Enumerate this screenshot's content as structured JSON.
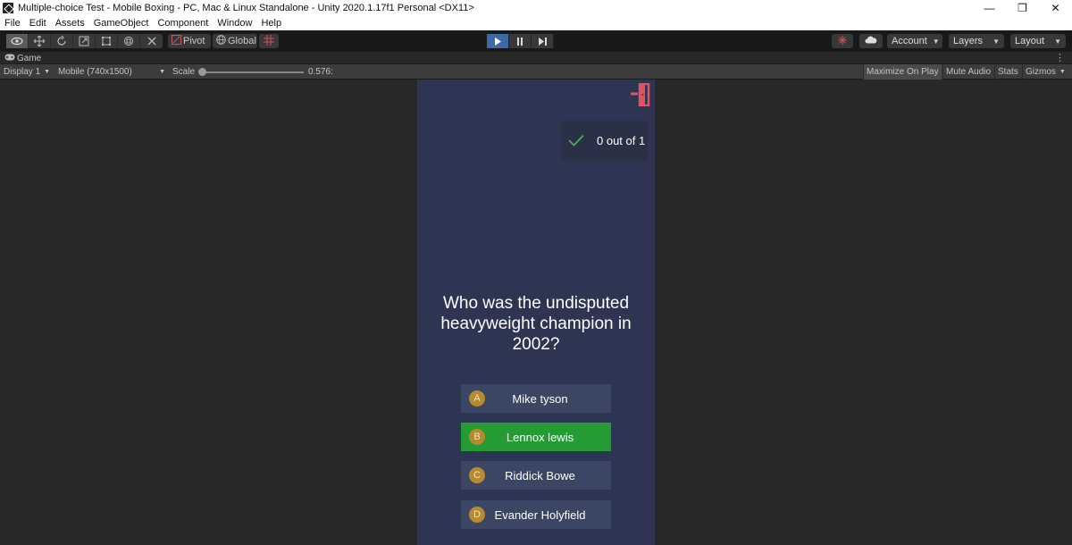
{
  "window": {
    "title": "Multiple-choice Test - Mobile Boxing - PC, Mac & Linux Standalone - Unity 2020.1.17f1 Personal <DX11>",
    "controls": {
      "minimize": "—",
      "restore": "❐",
      "close": "✕"
    }
  },
  "menu": {
    "items": [
      {
        "label": "File"
      },
      {
        "label": "Edit"
      },
      {
        "label": "Assets"
      },
      {
        "label": "GameObject"
      },
      {
        "label": "Component"
      },
      {
        "label": "Window"
      },
      {
        "label": "Help"
      }
    ]
  },
  "toolbar": {
    "pivot_label": "Pivot",
    "global_label": "Global",
    "account_label": "Account",
    "layers_label": "Layers",
    "layout_label": "Layout"
  },
  "game_tab": {
    "label": "Game"
  },
  "game_bar": {
    "display": "Display 1",
    "resolution": "Mobile (740x1500)",
    "scale_label": "Scale",
    "scale_value": "0.576:",
    "maximize_on_play": "Maximize On Play",
    "mute_audio": "Mute Audio",
    "stats": "Stats",
    "gizmos": "Gizmos"
  },
  "quiz": {
    "score_text": "0 out of 1",
    "question": "Who was the undisputed heavyweight champion in 2002?",
    "answers": [
      {
        "letter": "A",
        "text": "Mike tyson",
        "state": "default"
      },
      {
        "letter": "B",
        "text": "Lennox lewis",
        "state": "correct"
      },
      {
        "letter": "C",
        "text": "Riddick Bowe",
        "state": "default"
      },
      {
        "letter": "D",
        "text": "Evander Holyfield",
        "state": "default"
      }
    ]
  },
  "colors": {
    "phone_background": "#2d3553",
    "answer_default": "#3b4664",
    "answer_correct": "#249b35",
    "letter_badge": "#b88a30",
    "exit_icon": "#e05462",
    "check_icon": "#4caf50",
    "play_active": "#3a6aa8"
  }
}
